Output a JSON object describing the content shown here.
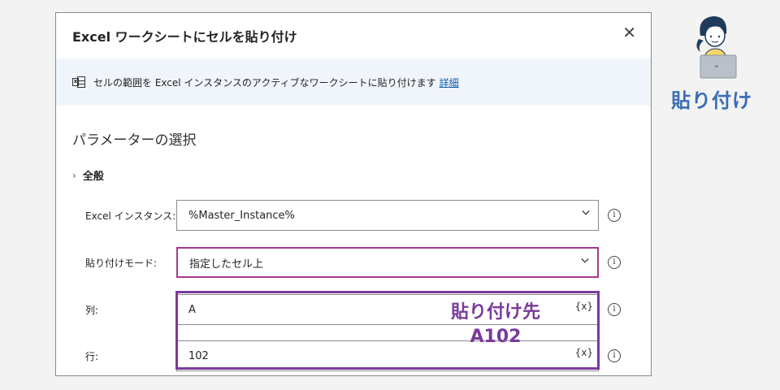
{
  "dialog": {
    "title": "Excel ワークシートにセルを貼り付け",
    "close_glyph": "✕",
    "info_text": "セルの範囲を Excel インスタンスのアクティブなワークシートに貼り付けます",
    "info_link": "詳細",
    "section_title": "パラメーターの選択",
    "general_label": "全般",
    "general_chevron": "›"
  },
  "fields": {
    "instance": {
      "label": "Excel インスタンス:",
      "value": "%Master_Instance%"
    },
    "paste_mode": {
      "label": "貼り付けモード:",
      "value": "指定したセル上"
    },
    "column": {
      "label": "列:",
      "value": "A",
      "var_glyph": "{x}"
    },
    "row": {
      "label": "行:",
      "value": "102",
      "var_glyph": "{x}"
    }
  },
  "info_glyph": "i",
  "callout": {
    "line1": "貼り付け先",
    "line2": "A102"
  },
  "side_label": "貼り付け",
  "colors": {
    "highlight": "#a33b8f",
    "callout": "#7a3a9a",
    "side_label": "#3b6db5",
    "info_bar": "#eff5fb"
  },
  "icons": [
    "excel-icon",
    "close-icon",
    "chevron-right-icon",
    "chevron-down-icon",
    "info-icon",
    "variable-icon",
    "person-laptop-illustration"
  ]
}
